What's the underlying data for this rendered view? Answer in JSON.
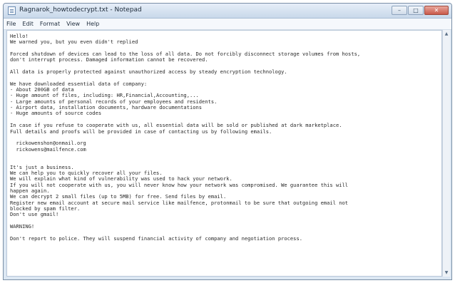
{
  "window": {
    "title": "Ragnarok_howtodecrypt.txt - Notepad",
    "controls": {
      "minimize": "–",
      "maximize": "□",
      "close": "✕"
    }
  },
  "menu": [
    "File",
    "Edit",
    "Format",
    "View",
    "Help"
  ],
  "note": {
    "lines": [
      "Hello!",
      "We warned you, but you even didn't replied",
      "",
      "Forced shutdown of devices can lead to the loss of all data. Do not forcibly disconnect storage volumes from hosts,",
      "don't interrupt process. Damaged information cannot be recovered.",
      "",
      "All data is properly protected against unauthorized access by steady encryption technology.",
      "",
      "We have downloaded essential data of company:",
      "- About 200GB of data",
      "- Huge amount of files, including: HR,Financial,Accounting,...",
      "- Large amounts of personal records of your employees and residents.",
      "- Airport data, installation documents, hardware documentations",
      "- Huge amounts of source codes",
      "",
      "In case if you refuse to cooperate with us, all essential data will be sold or published at dark marketplace.",
      "Full details and proofs will be provided in case of contacting us by following emails.",
      "",
      "  rickowenshon@onmail.org",
      "  rickowens@mailfence.com",
      "",
      "",
      "It's just a business.",
      "We can help you to quickly recover all your files.",
      "We will explain what kind of vulnerability was used to hack your network.",
      "If you will not cooperate with us, you will never know how your network was compromised. We guarantee this will",
      "happen again.",
      "We can decrypt 2 small files (up to 5MB) for free. Send files by email.",
      "Register new email account at secure mail service like mailfence, protonmail to be sure that outgoing email not",
      "blocked by spam filter.",
      "Don't use gmail!",
      "",
      "WARNING!",
      "",
      "Don't report to police. They will suspend financial activity of company and negotiation process."
    ]
  }
}
